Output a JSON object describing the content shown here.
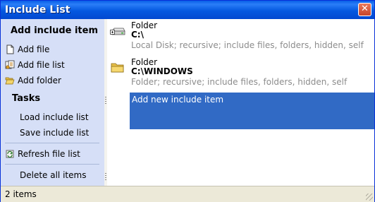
{
  "window": {
    "title": "Include List",
    "close_glyph": "✕"
  },
  "sidebar": {
    "add_section_title": "Add include item",
    "add_items": [
      {
        "label": "Add file",
        "icon": "file-icon"
      },
      {
        "label": "Add file list",
        "icon": "file-list-icon"
      },
      {
        "label": "Add folder",
        "icon": "folder-open-icon"
      }
    ],
    "tasks_section_title": "Tasks",
    "tasks": [
      {
        "label": "Load include list"
      },
      {
        "label": "Save include list"
      },
      {
        "label": "Refresh file list",
        "icon": "refresh-icon"
      },
      {
        "label": "Delete all items"
      }
    ]
  },
  "entries": [
    {
      "type": "Folder",
      "path": "C:\\",
      "description": "Local Disk; recursive; include files, folders, hidden, self",
      "icon": "drive-icon"
    },
    {
      "type": "Folder",
      "path": "C:\\WINDOWS",
      "description": "Folder; recursive; include files, folders, hidden, self",
      "icon": "folder-icon"
    }
  ],
  "add_new_item_label": "Add new include item",
  "status": {
    "count_text": "2 items"
  },
  "colors": {
    "titlebar": "#0558e0",
    "sidebar_bg": "#d6dff7",
    "selection": "#316ac5",
    "description_text": "#8c8c8c"
  }
}
